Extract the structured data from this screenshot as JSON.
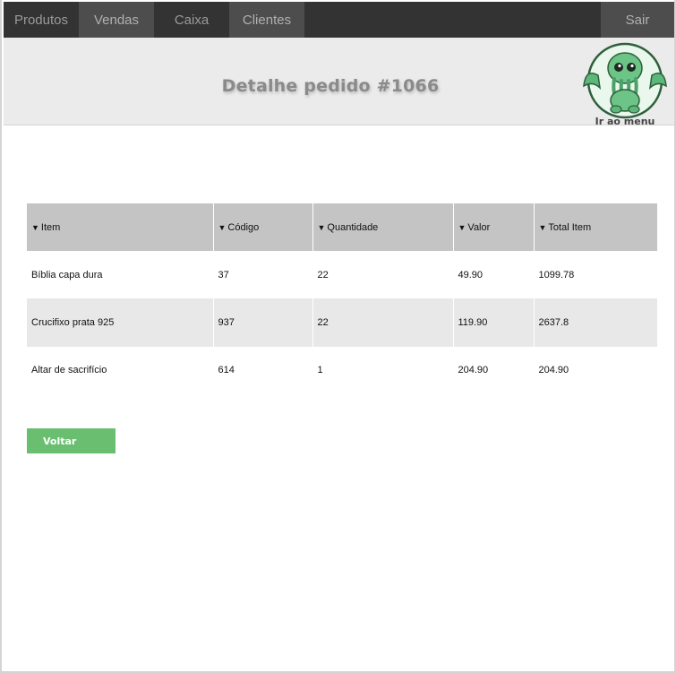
{
  "nav": {
    "items": [
      {
        "label": "Produtos",
        "active": false
      },
      {
        "label": "Vendas",
        "active": true
      },
      {
        "label": "Caixa",
        "active": false
      },
      {
        "label": "Clientes",
        "active": true
      }
    ],
    "logout_label": "Sair"
  },
  "header": {
    "title": "Detalhe pedido #1066",
    "menu_link_label": "Ir ao menu",
    "mascot_icon": "cthulhu-mascot-icon"
  },
  "table": {
    "sort_icon": "sort-down-arrow-icon",
    "columns": [
      "Item",
      "Código",
      "Quantidade",
      "Valor",
      "Total Item"
    ],
    "rows": [
      [
        "Bíblia capa dura",
        "37",
        "22",
        "49.90",
        "1099.78"
      ],
      [
        "Crucifixo prata 925",
        "937",
        "22",
        "119.90",
        "2637.8"
      ],
      [
        "Altar de sacrifício",
        "614",
        "1",
        "204.90",
        "204.90"
      ]
    ]
  },
  "actions": {
    "back_label": "Voltar"
  },
  "colors": {
    "nav_bg": "#333333",
    "nav_active_bg": "#4d4d4d",
    "header_bg": "#ebebeb",
    "table_header_bg": "#c4c4c4",
    "row_alt_bg": "#e8e8e8",
    "button_green": "#69bf6f",
    "mascot_green": "#5cb87a"
  }
}
